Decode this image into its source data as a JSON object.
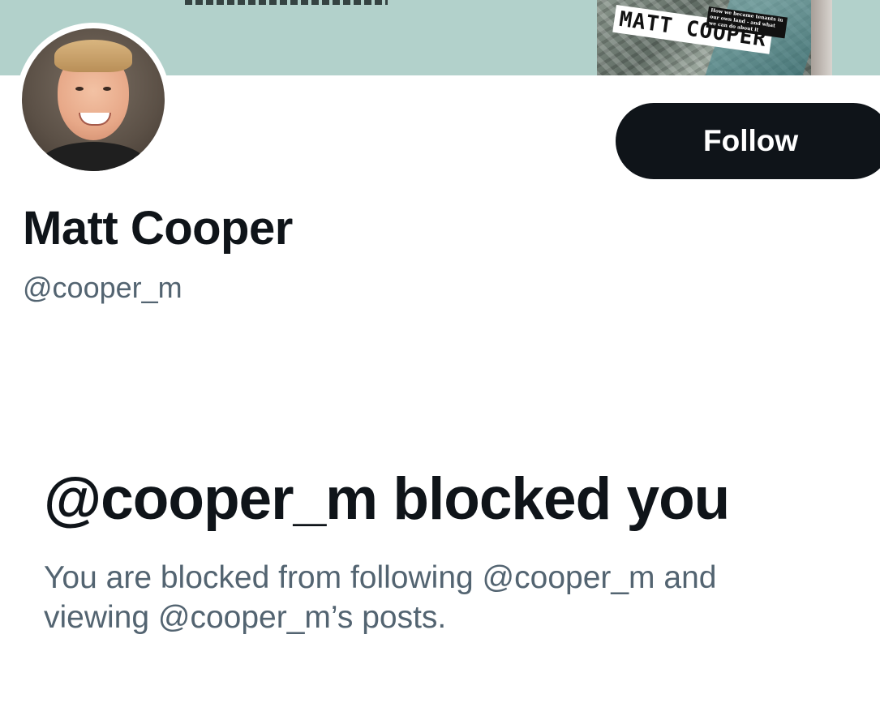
{
  "banner": {
    "book_author": "MATT COOPER",
    "book_tagline": "How we became tenants in our own land - and what we can do about it"
  },
  "profile": {
    "display_name": "Matt Cooper",
    "handle": "@cooper_m",
    "follow_label": "Follow"
  },
  "blocked": {
    "title": "@cooper_m blocked you",
    "message": "You are blocked from following @cooper_m and viewing @cooper_m’s posts."
  },
  "colors": {
    "banner": "#b2d1cb",
    "primary_text": "#0f1419",
    "secondary_text": "#536471",
    "button_bg": "#0f1419",
    "button_text": "#ffffff"
  }
}
